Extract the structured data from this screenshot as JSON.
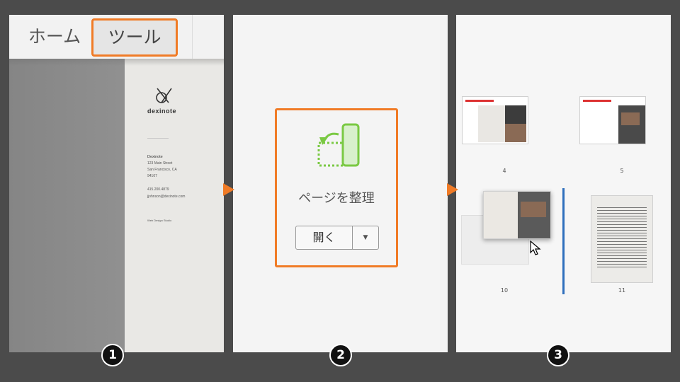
{
  "step1": {
    "tabs": {
      "home": "ホーム",
      "tools": "ツール"
    },
    "document": {
      "brand": "dexinote",
      "address_lines": [
        "Dexinote",
        "123 Main Street",
        "San Francisco, CA",
        "94107",
        "415.200.4879",
        "jjohnson@dexinote.com",
        "Web Design Studio"
      ]
    }
  },
  "step2": {
    "tool_name": "ページを整理",
    "open_button": "開く",
    "dropdown_icon": "caret-down-icon"
  },
  "step3": {
    "thumbnails": [
      {
        "page": "4"
      },
      {
        "page": "5"
      },
      {
        "page": "10"
      },
      {
        "page": "11"
      }
    ]
  },
  "steps": [
    "1",
    "2",
    "3"
  ],
  "colors": {
    "accent": "#f07b26",
    "insert_marker": "#2f6fbd",
    "icon_green": "#7ac943",
    "background": "#4b4b4b"
  }
}
